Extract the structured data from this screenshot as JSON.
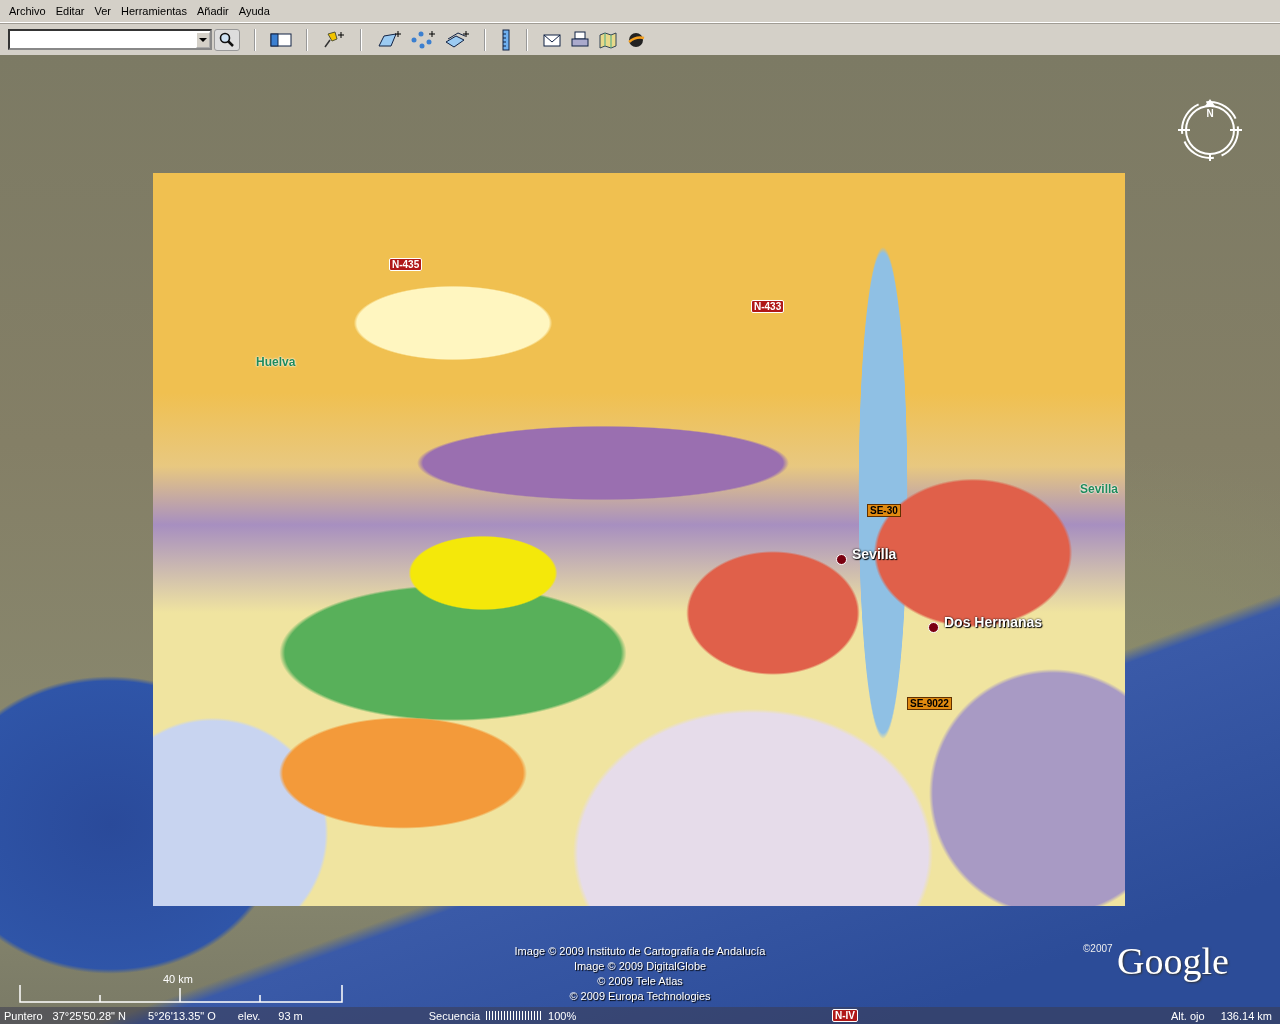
{
  "menu": [
    "Archivo",
    "Editar",
    "Ver",
    "Herramientas",
    "Añadir",
    "Ayuda"
  ],
  "compass": {
    "label": "N"
  },
  "map_labels": [
    {
      "text": "N-435",
      "kind": "road_red"
    },
    {
      "text": "N-433",
      "kind": "road_red"
    },
    {
      "text": "Huelva",
      "kind": "region"
    },
    {
      "text": "Sevilla",
      "kind": "region"
    },
    {
      "text": "SE-30",
      "kind": "road_orange"
    },
    {
      "text": "Sevilla",
      "kind": "city"
    },
    {
      "text": "Dos Hermanas",
      "kind": "city"
    },
    {
      "text": "SE-9022",
      "kind": "road_orange"
    },
    {
      "text": "N-IV",
      "kind": "road_red"
    }
  ],
  "copyright": [
    "Image © 2009 Instituto de Cartografía de Andalucía",
    "Image © 2009 DigitalGlobe",
    "© 2009 Tele Atlas",
    "© 2009 Europa Technologies"
  ],
  "logo": {
    "year": "©2007",
    "text": "Google"
  },
  "scale": {
    "label": "40 km"
  },
  "status_bar": {
    "pointer_label": "Puntero",
    "latitude": "37°25'50.28\" N",
    "longitude": "5°26'13.35\" O",
    "elev_label": "elev.",
    "elev": "93 m",
    "streaming_label": "Secuencia",
    "streaming": {
      "level": 1
    },
    "streaming_percent": "100%",
    "eye_label": "Alt. ojo",
    "eye_alt": "136.14 km"
  }
}
